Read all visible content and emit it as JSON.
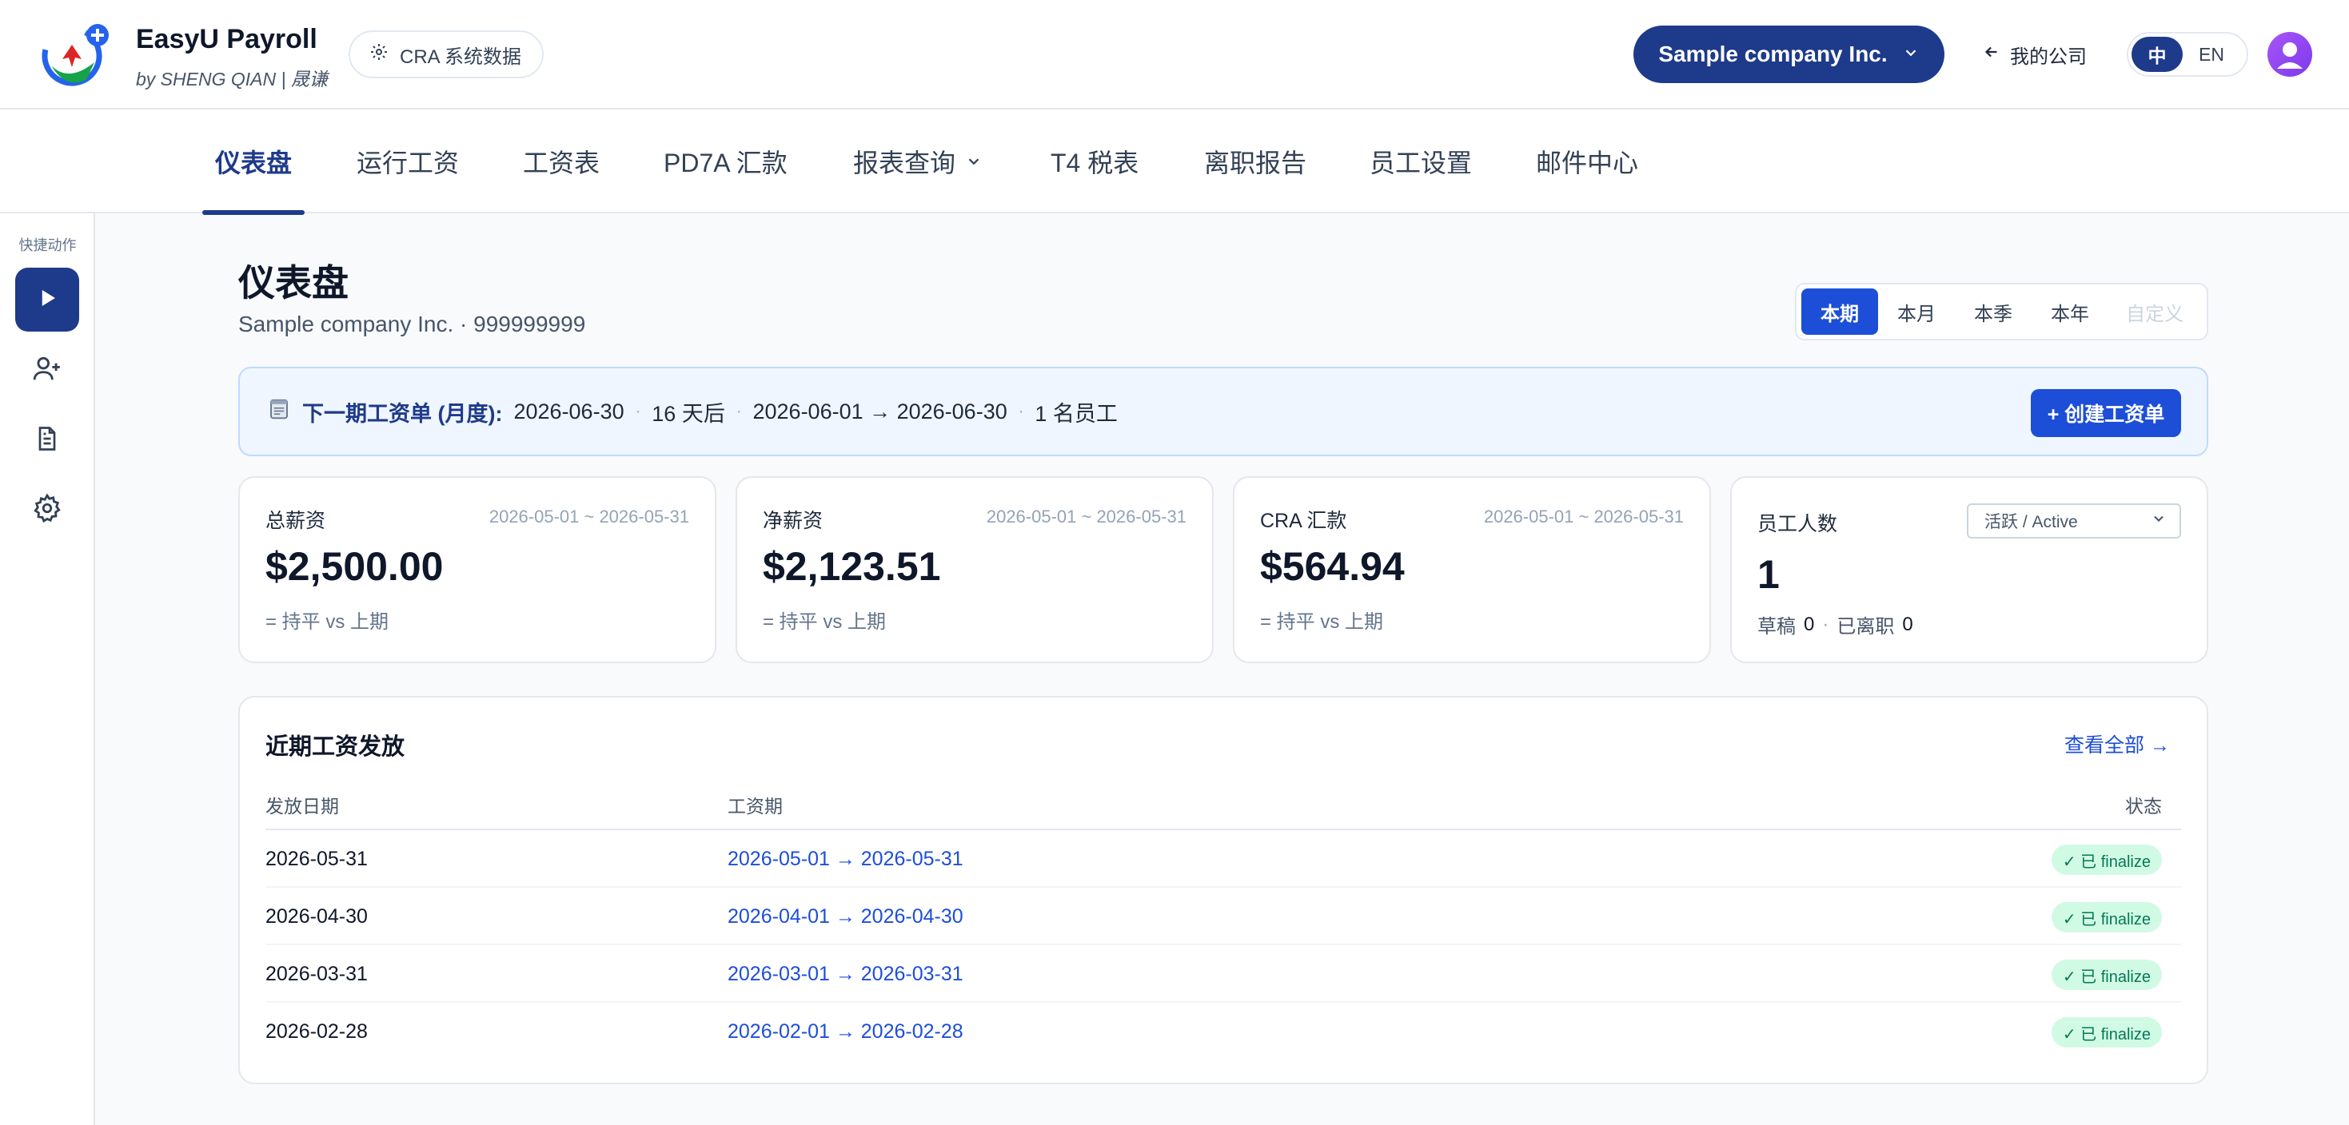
{
  "header": {
    "brand_name": "EasyU Payroll",
    "brand_sub": "by SHENG QIAN | 晟谦",
    "cra_label": "CRA 系统数据",
    "company": "Sample company Inc.",
    "back_label": "我的公司",
    "lang_zh": "中",
    "lang_en": "EN",
    "accent": "#1e3a8a"
  },
  "nav": {
    "items": [
      "仪表盘",
      "运行工资",
      "工资表",
      "PD7A 汇款",
      "报表查询",
      "T4 税表",
      "离职报告",
      "员工设置",
      "邮件中心"
    ],
    "active_index": 0
  },
  "sidebar": {
    "title": "快捷动作",
    "icons": [
      "play-icon",
      "add-user-icon",
      "document-icon",
      "gear-icon"
    ]
  },
  "page": {
    "title": "仪表盘",
    "subtitle": "Sample company Inc. · 999999999",
    "periods": [
      "本期",
      "本月",
      "本季",
      "本年",
      "自定义"
    ],
    "active_period": "本期"
  },
  "banner": {
    "label": "下一期工资单 (月度):",
    "date": "2026-06-30",
    "days": "16 天后",
    "range": "2026-06-01 → 2026-06-30",
    "employees": "1 名员工",
    "button": "+ 创建工资单"
  },
  "cards": [
    {
      "label": "总薪资",
      "range": "2026-05-01 ~ 2026-05-31",
      "value": "$2,500.00",
      "delta": "= 持平 vs 上期"
    },
    {
      "label": "净薪资",
      "range": "2026-05-01 ~ 2026-05-31",
      "value": "$2,123.51",
      "delta": "= 持平 vs 上期"
    },
    {
      "label": "CRA 汇款",
      "range": "2026-05-01 ~ 2026-05-31",
      "value": "$564.94",
      "delta": "= 持平 vs 上期"
    }
  ],
  "employees_card": {
    "label": "员工人数",
    "filter": "活跃 / Active",
    "count": "1",
    "draft_label": "草稿",
    "draft_count": "0",
    "left_label": "已离职",
    "left_count": "0"
  },
  "recent": {
    "title": "近期工资发放",
    "view_all": "查看全部 →",
    "columns": [
      "发放日期",
      "工资期",
      "状态"
    ],
    "rows": [
      {
        "date": "2026-05-31",
        "period": "2026-05-01 → 2026-05-31",
        "status": "✓ 已 finalize"
      },
      {
        "date": "2026-04-30",
        "period": "2026-04-01 → 2026-04-30",
        "status": "✓ 已 finalize"
      },
      {
        "date": "2026-03-31",
        "period": "2026-03-01 → 2026-03-31",
        "status": "✓ 已 finalize"
      },
      {
        "date": "2026-02-28",
        "period": "2026-02-01 → 2026-02-28",
        "status": "✓ 已 finalize"
      }
    ]
  }
}
